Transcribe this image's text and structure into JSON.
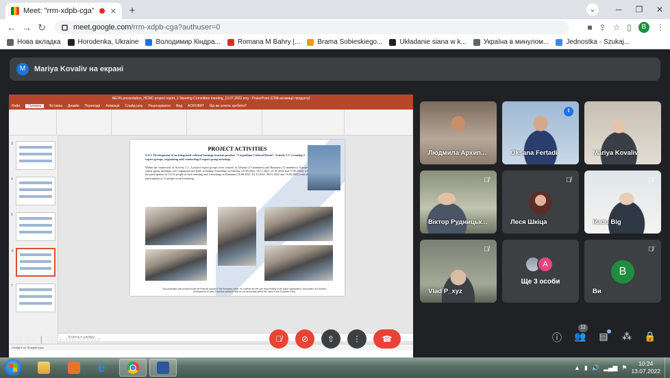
{
  "browser": {
    "tab_title": "Meet: \"rrm-xdpb-cga\"",
    "tab_close": "✕",
    "new_tab": "+",
    "url_host": "meet.google.com",
    "url_path": "/rrm-xdpb-cga?authuser=0",
    "profile_initial": "B",
    "bookmarks": [
      {
        "label": "Нова вкладка",
        "color": "#5f6368"
      },
      {
        "label": "Horodenka, Ukraine",
        "color": "#202124"
      },
      {
        "label": "Володимир Кіндра...",
        "color": "#1a73e8"
      },
      {
        "label": "Romana M Bahry |...",
        "color": "#d93025"
      },
      {
        "label": "Brama Sobieskiego...",
        "color": "#f29900"
      },
      {
        "label": "Układanie siana w k...",
        "color": "#202124"
      },
      {
        "label": "Україна в минулом...",
        "color": "#5f6368"
      },
      {
        "label": "Jednostka - Szukaj...",
        "color": "#4285f4"
      }
    ]
  },
  "meet": {
    "presenter_initial": "M",
    "presenter_text": "Mariya Kovaliv на екрані",
    "meeting_time": "10:24",
    "separator": "|",
    "meeting_code": "rrm-xdpb-cga",
    "participants_count": "12",
    "participants": [
      {
        "name": "Людмила Архип...",
        "style": "warm",
        "muted": false
      },
      {
        "name": "Oksana Fertadi",
        "style": "blue",
        "muted": false,
        "speaking": true
      },
      {
        "name": "Mariya Kovaliv",
        "style": "room",
        "muted": false
      },
      {
        "name": "Віктор Рудницьк...",
        "style": "office",
        "muted": true
      },
      {
        "name": "Леся Шкіца",
        "style": "avatar",
        "muted": true
      },
      {
        "name": "Radu Big",
        "style": "light",
        "muted": true
      },
      {
        "name": "Vlad P_xyz",
        "style": "elder",
        "muted": true
      },
      {
        "name": "Ще 3 особи",
        "style": "group",
        "muted": false,
        "extra_initial": "A"
      },
      {
        "name": "Ви",
        "style": "letter",
        "muted": true,
        "initial": "B"
      }
    ]
  },
  "ppt": {
    "window_title": "AEON presentation_HCMC project report_1 Steering Committee meeting_13.07.2022.eng - PowerPoint (Сбій активації продукту)",
    "tabs": [
      "Файл",
      "Головна",
      "Вставка",
      "Дизайн",
      "Переходи",
      "Анімація",
      "Слайд-шоу",
      "Рецензування",
      "Вид",
      "ACROBAT",
      "Що ви хочете зробити?"
    ],
    "slide": {
      "title": "PROJECT ACTIVITIES",
      "subtitle": "GA 1. Development of an integrated cultural heritage tourism product \"Carpathian Cultural Route\" Activity 1.1. Creating 2 expert groups, organizing and conducting 8 expert group meetings",
      "paragraph": "Within the framework of Activity 1.1. 2 project expert groups were created: in Ukraine (15 members) and Romania (12 members). 8 project expert group meetings were organized and held, including 4 meetings in Ukraine (15.09.2021, 18.11.2021, 21.01.2022 and 17.06.2022) with the participation of 14-15 people in each meeting and 4 meetings in Romania (16.09.2021, 02.12.2021, 18.01.2022 and 16.06.2022) with the participation of 12 people in each meeting",
      "footer": "This publication was produced with the financial support of the European Union. Its contents are the sole responsibility of the public organization \"Association of Economic Development of Ivano-Frankivsk oblAsDP\" and do not necessarily reflect the views of the European Union"
    },
    "thumb_numbers": [
      "3",
      "4",
      "5",
      "6",
      "7"
    ],
    "notes_placeholder": "Замітки к слайду",
    "status": "Слайд 6 из 76   українська"
  },
  "taskbar": {
    "time": "10:24",
    "date": "13.07.2022",
    "lang": "UK"
  }
}
